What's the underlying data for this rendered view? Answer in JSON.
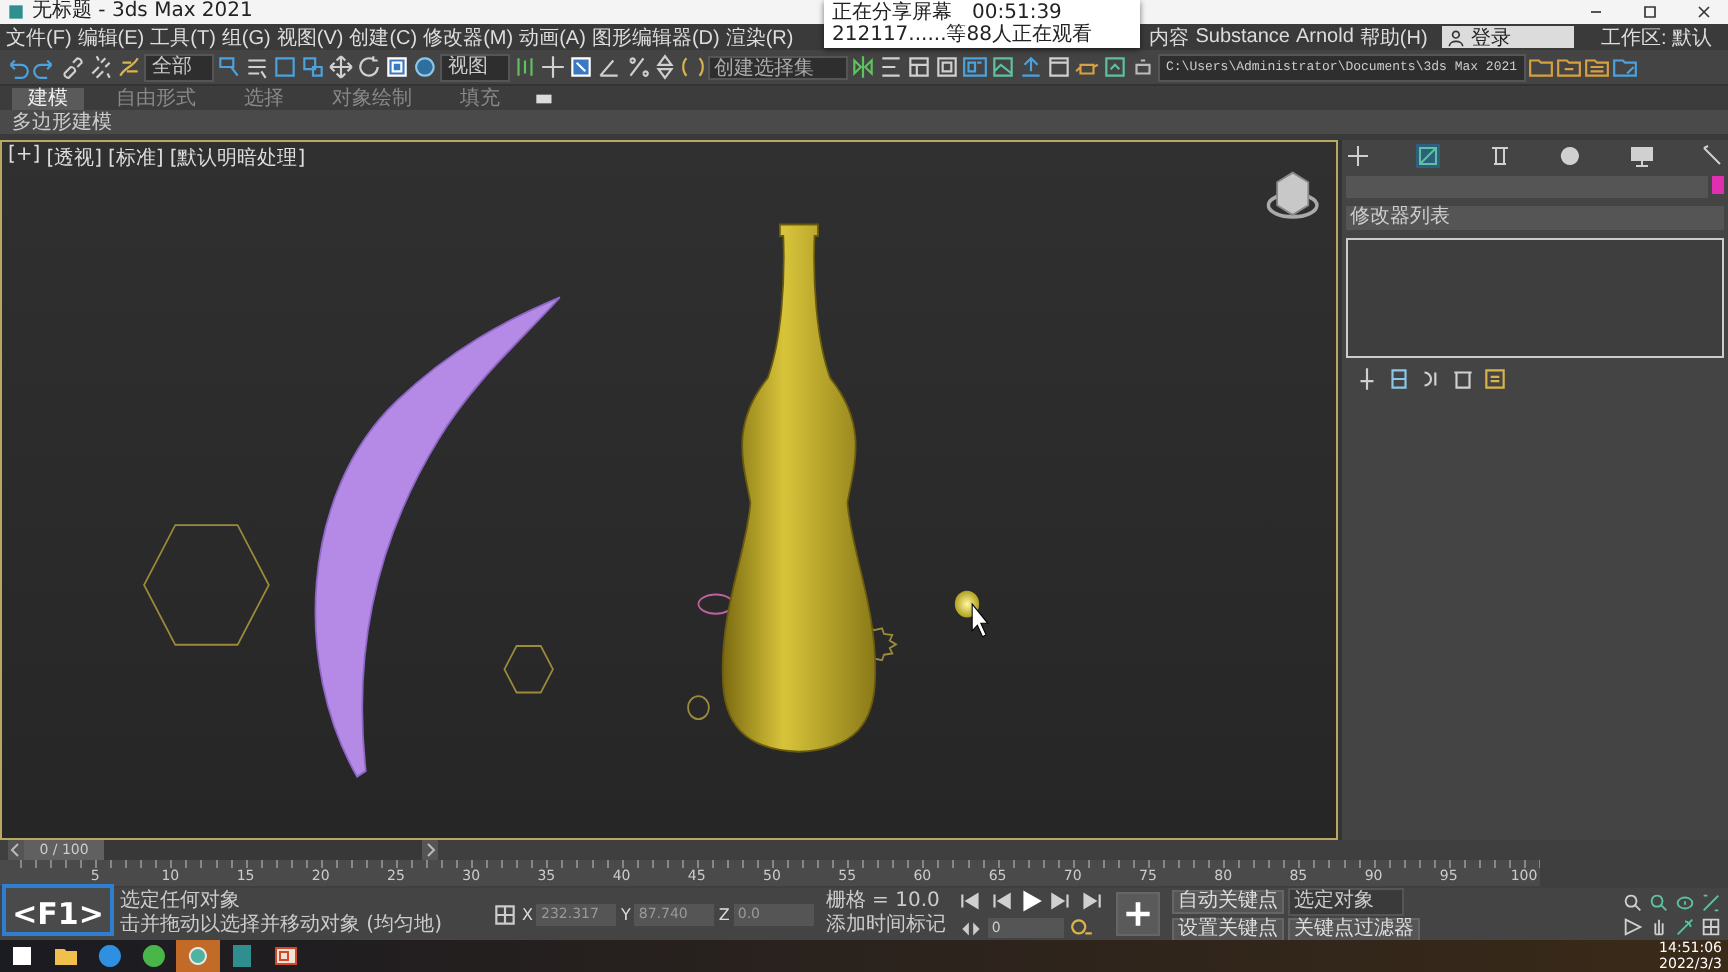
{
  "window": {
    "title": "无标题 - 3ds Max 2021"
  },
  "share_popup": {
    "status": "正在分享屏幕",
    "timer": "00:51:39",
    "viewers": "212117......等88人正在观看"
  },
  "menu": {
    "items": [
      "文件(F)",
      "编辑(E)",
      "工具(T)",
      "组(G)",
      "视图(V)",
      "创建(C)",
      "修改器(M)",
      "动画(A)",
      "图形编辑器(D)",
      "渲染(R)"
    ],
    "more_items": [
      "内容",
      "Substance",
      "Arnold",
      "帮助(H)"
    ],
    "account": "登录",
    "workspace": "工作区: 默认"
  },
  "toolbar": {
    "filter": "全部",
    "ref_coord": "视图",
    "selection_set": {
      "placeholder": "创建选择集"
    },
    "project_path": "C:\\Users\\Administrator\\Documents\\3ds Max 2021"
  },
  "ribbon": {
    "tabs": [
      {
        "label": "建模",
        "selected": true
      },
      {
        "label": "自由形式",
        "selected": false
      },
      {
        "label": "选择",
        "selected": false
      },
      {
        "label": "对象绘制",
        "selected": false
      },
      {
        "label": "填充",
        "selected": false
      }
    ],
    "panel": "多边形建模"
  },
  "viewport": {
    "labels": [
      "[+]",
      "[透视]",
      "[标准]",
      "[默认明暗处理]"
    ]
  },
  "command_panel": {
    "tabs": [
      {
        "selected": false
      },
      {
        "selected": true
      },
      {
        "selected": false
      },
      {
        "selected": false
      },
      {
        "selected": false
      },
      {
        "selected": false
      }
    ],
    "modifier_list": "修改器列表"
  },
  "timeline": {
    "frame": "0 / 100",
    "level": 0,
    "ticks": [
      "5",
      "10",
      "15",
      "20",
      "25",
      "30",
      "35",
      "40",
      "45",
      "50",
      "55",
      "60",
      "65",
      "70",
      "75",
      "80",
      "85",
      "90",
      "95",
      "100"
    ]
  },
  "status": {
    "lines": [
      "选定任何对象",
      "击并拖动以选择并移动对象 (均匀地)"
    ],
    "coords": [
      {
        "axis": "X",
        "value": "232.317"
      },
      {
        "axis": "Y",
        "value": "87.740"
      },
      {
        "axis": "Z",
        "value": "0.0"
      }
    ],
    "grid": "栅格 = 10.0",
    "time_tag": "添加时间标记",
    "current_frame": "0",
    "auto_key": "自动关键点",
    "key_mode": "选定对象",
    "set_key": "设置关键点",
    "key_filters": "关键点过滤器"
  },
  "key_overlay": "<F1>",
  "taskbar": {
    "time": "14:51:06",
    "date": "2022/3/3"
  }
}
